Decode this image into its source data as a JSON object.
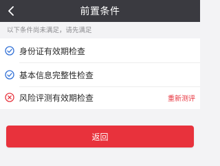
{
  "header": {
    "title": "前置条件"
  },
  "hint": "以下条件尚未满足，请先满足",
  "conditions": [
    {
      "label": "身份证有效期检查",
      "status": "passed",
      "icon": "check-circle-icon",
      "color": "#2f6fd6"
    },
    {
      "label": "基本信息完整性检查",
      "status": "passed",
      "icon": "check-circle-icon",
      "color": "#2f6fd6"
    },
    {
      "label": "风险评测有效期检查",
      "status": "failed",
      "icon": "x-circle-icon",
      "color": "#e7353f",
      "action": "重新测评"
    }
  ],
  "footer": {
    "return_label": "返回"
  },
  "colors": {
    "header_bg": "#3a3a40",
    "accent_red": "#e8323c",
    "check_blue": "#2f6fd6"
  }
}
